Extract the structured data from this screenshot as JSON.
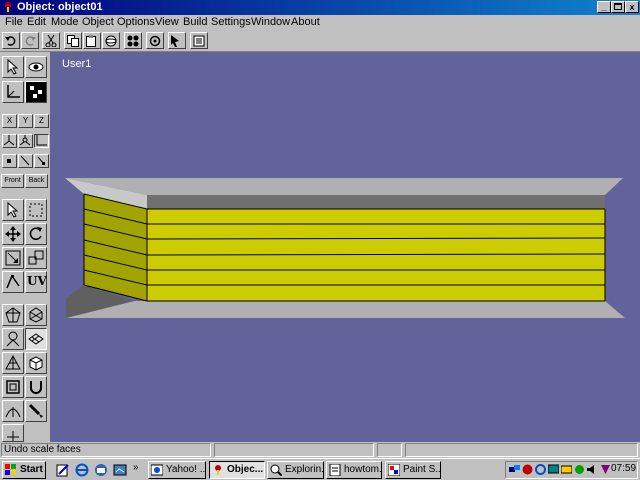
{
  "window": {
    "title": "Object: object01",
    "minimize": "_",
    "close": "x"
  },
  "menu": [
    "File",
    "Edit",
    "Mode",
    "Object",
    "Options",
    "View",
    "Build",
    "Settings",
    "Window",
    "About"
  ],
  "left_panel": {
    "axis_x": "X",
    "axis_y": "Y",
    "axis_z": "Z",
    "front": "Front",
    "back": "Back",
    "uv": "UV"
  },
  "viewport": {
    "label": "User1",
    "colors": {
      "background": "#63639c",
      "face_yellow": "#cccc00",
      "side_olive": "#a3a300",
      "top_grey": "#b0b0b0",
      "dark_grey": "#606060"
    }
  },
  "status": {
    "message": "Undo scale faces"
  },
  "taskbar": {
    "start": "Start",
    "more": "»",
    "tasks": [
      {
        "label": "Yahoo! ...",
        "active": false
      },
      {
        "label": "Objec...",
        "active": true
      },
      {
        "label": "Explorin...",
        "active": false
      },
      {
        "label": "howtom...",
        "active": false
      },
      {
        "label": "Paint S...",
        "active": false
      }
    ],
    "clock": "07:59"
  }
}
